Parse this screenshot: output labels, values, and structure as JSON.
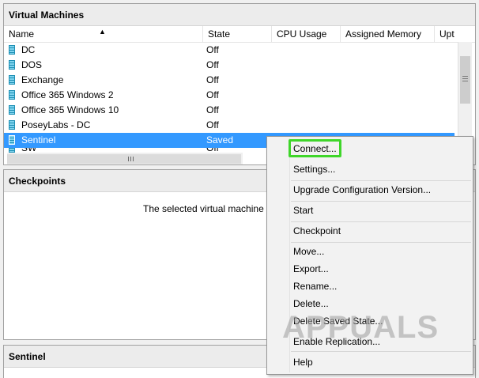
{
  "vm_panel": {
    "title": "Virtual Machines",
    "columns": [
      "Name",
      "State",
      "CPU Usage",
      "Assigned Memory",
      "Upt"
    ],
    "rows": [
      {
        "name": "DC",
        "state": "Off"
      },
      {
        "name": "DOS",
        "state": "Off"
      },
      {
        "name": "Exchange",
        "state": "Off"
      },
      {
        "name": "Office 365 Windows 2",
        "state": "Off"
      },
      {
        "name": "Office 365 Windows 10",
        "state": "Off"
      },
      {
        "name": "PoseyLabs - DC",
        "state": "Off"
      },
      {
        "name": "Sentinel",
        "state": "Saved"
      }
    ],
    "partial_row": {
      "name": "SW",
      "state": "Off"
    }
  },
  "checkpoints": {
    "title": "Checkpoints",
    "message": "The selected virtual machine has"
  },
  "detail": {
    "title": "Sentinel"
  },
  "context_menu": {
    "items": [
      "Connect...",
      "Settings...",
      "Upgrade Configuration Version...",
      "Start",
      "Checkpoint",
      "Move...",
      "Export...",
      "Rename...",
      "Delete...",
      "Delete Saved State...",
      "Enable Replication...",
      "Help"
    ],
    "highlight_color": "#3fd62a"
  },
  "watermark": "APPUALS",
  "colors": {
    "selection": "#3399ff",
    "vm_icon": "#1e8fb4"
  }
}
